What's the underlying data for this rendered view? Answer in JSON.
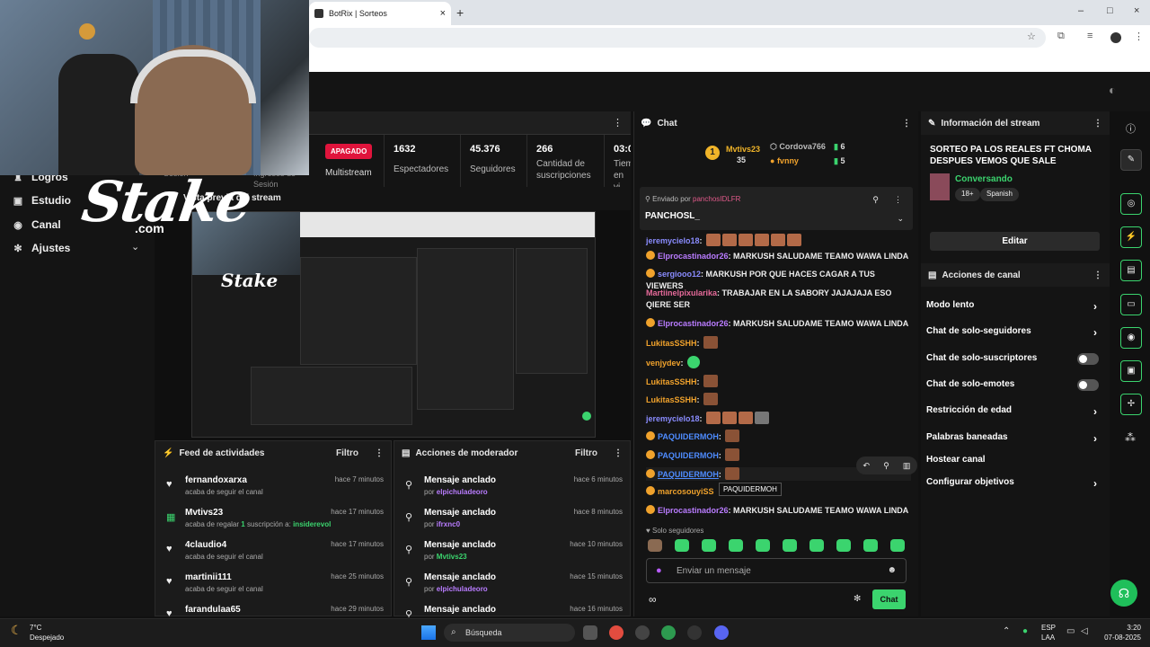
{
  "browser": {
    "tab_title": "BotRix | Sorteos",
    "new_tab": "+",
    "close": "×",
    "min": "–",
    "max": "□",
    "win_close": "×"
  },
  "sidebar": {
    "items": [
      {
        "label": "Logros",
        "icon": "trophy-icon"
      },
      {
        "label": "Estudio",
        "icon": "camera-icon"
      },
      {
        "label": "Canal",
        "icon": "channel-icon"
      },
      {
        "label": "Ajustes",
        "icon": "gear-icon"
      }
    ]
  },
  "overlay": {
    "logo": "Stake",
    "logo_com": ".com"
  },
  "stats": {
    "status": "APAGADO",
    "multistream": "Multistream",
    "sesion": "Sesión",
    "ingresos": "Ingresos de Sesión",
    "viewers_value": "1632",
    "viewers_label": "Espectadores",
    "followers_value": "45.376",
    "followers_label": "Seguidores",
    "subs_value": "266",
    "subs_label": "Cantidad de suscripciones",
    "time_value": "03:0",
    "time_label": "Tiem en vi"
  },
  "preview": {
    "title": "Vista previa del stream"
  },
  "feed": {
    "title": "Feed de actividades",
    "filter": "Filtro",
    "rows": [
      {
        "name": "fernandoxarxa",
        "sub": "acaba de seguir el canal",
        "time": "hace 7 minutos",
        "icon": "heart-icon"
      },
      {
        "name": "Mvtivs23",
        "sub_pre": "acaba de regalar ",
        "sub_count": "1",
        "sub_mid": " suscripción a: ",
        "sub_user": "insiderevol",
        "time": "hace 17 minutos",
        "icon": "gift-icon"
      },
      {
        "name": "4claudio4",
        "sub": "acaba de seguir el canal",
        "time": "hace 17 minutos",
        "icon": "heart-icon"
      },
      {
        "name": "martinii111",
        "sub": "acaba de seguir el canal",
        "time": "hace 25 minutos",
        "icon": "heart-icon"
      },
      {
        "name": "farandulaa65",
        "sub": "",
        "time": "hace 29 minutos",
        "icon": "heart-icon"
      }
    ]
  },
  "modactions": {
    "title": "Acciones de moderador",
    "filter": "Filtro",
    "rows": [
      {
        "name": "Mensaje anclado",
        "by": "elpichuladeoro",
        "time": "hace 6 minutos"
      },
      {
        "name": "Mensaje anclado",
        "by": "ifrxnc0",
        "time": "hace 8 minutos"
      },
      {
        "name": "Mensaje anclado",
        "by": "Mvtivs23",
        "time": "hace 10 minutos"
      },
      {
        "name": "Mensaje anclado",
        "by": "elpichuladeoro",
        "time": "hace 15 minutos"
      },
      {
        "name": "Mensaje anclado",
        "by": "",
        "time": "hace 16 minutos"
      }
    ],
    "by_prefix": "por"
  },
  "chat": {
    "title": "Chat",
    "leaderboard": {
      "first_rank": "1",
      "first_name": "Mvtivs23",
      "first_pts": "35",
      "second_name": "Cordova766",
      "second_pts": "6",
      "third_name": "fvnny",
      "third_pts": "5"
    },
    "pinned": {
      "by_label": "Enviado por",
      "by_user": "panchosIDLFR",
      "message": "PANCHOSL_"
    },
    "lines": [
      {
        "user": "jeremycielo18",
        "color": "#8a8cff",
        "text": "",
        "emotes": 6,
        "badge": false
      },
      {
        "user": "Elprocastinador26",
        "color": "#b97cff",
        "text": "MARKUSH SALUDAME TEAMO WAWA LINDA",
        "badge": true
      },
      {
        "user": "sergiooo12",
        "color": "#8a8cff",
        "text": "MARKUSH POR QUE HACES CAGAR A TUS VIEWERS",
        "badge": true
      },
      {
        "user": "Martiinelpixularika",
        "color": "#e66a9a",
        "text": "TRABAJAR EN LA SABORY JAJAJAJA ESO QIERE SER",
        "badge": false
      },
      {
        "user": "Elprocastinador26",
        "color": "#b97cff",
        "text": "MARKUSH SALUDAME TEAMO WAWA LINDA",
        "badge": true
      },
      {
        "user": "LukitasSSHH",
        "color": "#f0a22c",
        "text": "",
        "badge": false
      },
      {
        "user": "venjydev",
        "color": "#f0a22c",
        "text": "",
        "badge": false
      },
      {
        "user": "LukitasSSHH",
        "color": "#f0a22c",
        "text": "",
        "badge": false
      },
      {
        "user": "LukitasSSHH",
        "color": "#f0a22c",
        "text": "",
        "badge": false
      },
      {
        "user": "jeremycielo18",
        "color": "#8a8cff",
        "text": "",
        "badge": false
      },
      {
        "user": "PAQUIDERMOH",
        "color": "#4e8cff",
        "text": "",
        "badge": true
      },
      {
        "user": "PAQUIDERMOH",
        "color": "#4e8cff",
        "text": "",
        "badge": true
      },
      {
        "user": "PAQUIDERMOH",
        "color": "#4e8cff",
        "text": "",
        "badge": true
      },
      {
        "user": "marcosouyiSS",
        "color": "#f0a22c",
        "text": "",
        "badge": true
      },
      {
        "user": "Elprocastinador26",
        "color": "#b97cff",
        "text": "MARKUSH SALUDAME TEAMO WAWA LINDA",
        "badge": true
      }
    ],
    "tooltip": "PAQUIDERMOH",
    "solo": "Solo seguidores",
    "input_placeholder": "Enviar un mensaje",
    "send": "Chat"
  },
  "info": {
    "title": "Información del stream",
    "stream_title": "SORTEO PA LOS REALES FT CHOMA DESPUES VEMOS QUE SALE",
    "category": "Conversando",
    "age": "18+",
    "language": "Spanish",
    "edit": "Editar"
  },
  "channel_actions": {
    "title": "Acciones de canal",
    "items": [
      {
        "label": "Modo lento",
        "kind": "chevron"
      },
      {
        "label": "Chat de solo-seguidores",
        "kind": "chevron"
      },
      {
        "label": "Chat de solo-suscriptores",
        "kind": "toggle"
      },
      {
        "label": "Chat de solo-emotes",
        "kind": "toggle"
      },
      {
        "label": "Restricción de edad",
        "kind": "chevron"
      },
      {
        "label": "Palabras baneadas",
        "kind": "chevron"
      },
      {
        "label": "Hostear canal",
        "kind": "none"
      },
      {
        "label": "Configurar objetivos",
        "kind": "chevron"
      }
    ]
  },
  "taskbar": {
    "temp": "7°C",
    "weather": "Despejado",
    "search": "Búsqueda",
    "lang1": "ESP",
    "lang2": "LAA",
    "time": "3:20",
    "date": "07-08-2025"
  },
  "colors": {
    "accent": "#3bd46e",
    "danger": "#e0143c",
    "gold": "#f0b429"
  }
}
